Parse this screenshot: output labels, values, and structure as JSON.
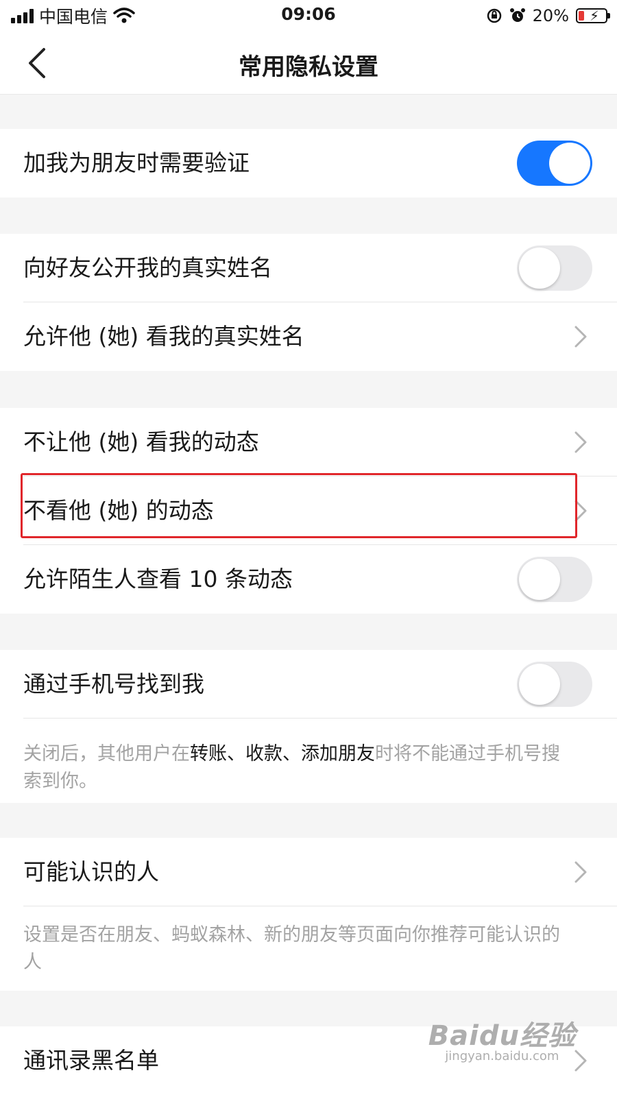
{
  "status_bar": {
    "carrier": "中国电信",
    "time": "09:06",
    "battery": "20%"
  },
  "nav": {
    "title": "常用隐私设置"
  },
  "settings": {
    "friend_verify": {
      "label": "加我为朋友时需要验证",
      "enabled": true
    },
    "show_real_name": {
      "label": "向好友公开我的真实姓名",
      "enabled": false
    },
    "allow_view_real_name": {
      "label": "允许他 (她) 看我的真实姓名"
    },
    "hide_my_moments": {
      "label": "不让他 (她) 看我的动态"
    },
    "hide_their_moments": {
      "label": "不看他 (她) 的动态"
    },
    "stranger_10_moments": {
      "label": "允许陌生人查看 10 条动态",
      "enabled": false
    },
    "find_by_phone": {
      "label": "通过手机号找到我",
      "enabled": false
    },
    "phone_note": {
      "prefix": "关闭后，其他用户在",
      "highlight": "转账、收款、添加朋友",
      "suffix": "时将不能通过手机号搜索到你。"
    },
    "people_you_may_know": {
      "label": "可能认识的人"
    },
    "pymk_note": "设置是否在朋友、蚂蚁森林、新的朋友等页面向你推荐可能认识的人",
    "contacts_blacklist": {
      "label": "通讯录黑名单"
    }
  },
  "watermark": {
    "logo": "Baidu经验",
    "url": "jingyan.baidu.com"
  },
  "colors": {
    "accent": "#1677ff",
    "highlight_border": "#e0262b",
    "background": "#f5f5f5"
  }
}
